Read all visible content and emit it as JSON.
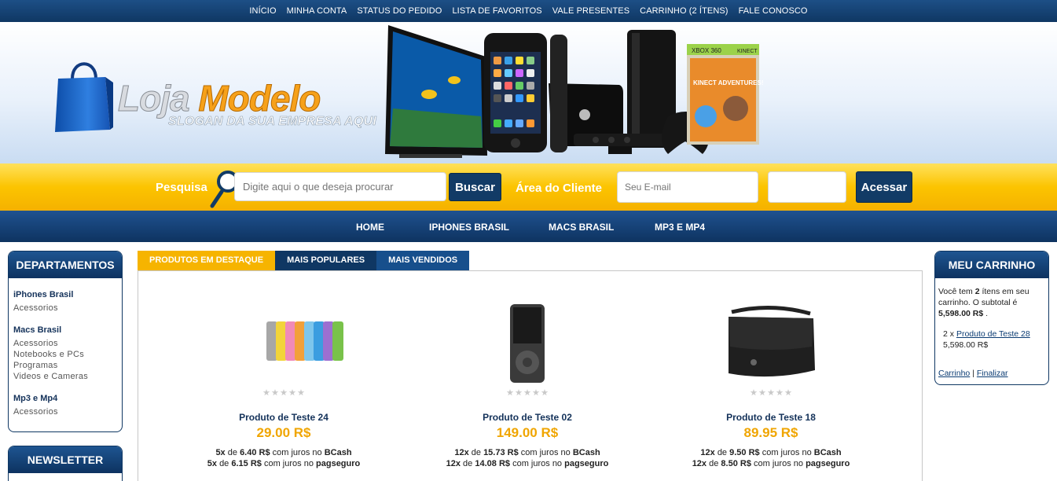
{
  "topnav": [
    "INÍCIO",
    "MINHA CONTA",
    "STATUS DO PEDIDO",
    "LISTA DE FAVORITOS",
    "VALE PRESENTES",
    "CARRINHO (2 ÍTENS)",
    "FALE CONOSCO"
  ],
  "brand": {
    "loja": "Loja",
    "modelo": "Modelo",
    "slogan": "SLOGAN DA SUA EMPRESA AQUI"
  },
  "banner_text": {
    "xbox": "XBOX 360",
    "kinect": "KINECT",
    "game": "KINECT ADVENTURES!"
  },
  "search": {
    "label": "Pesquisa",
    "placeholder": "Digite aqui o que deseja procurar",
    "button": "Buscar"
  },
  "client": {
    "label": "Área do Cliente",
    "email_placeholder": "Seu E-mail",
    "button": "Acessar"
  },
  "mainnav": [
    "HOME",
    "IPHONES BRASIL",
    "MACS BRASIL",
    "MP3 E MP4"
  ],
  "departments": {
    "title": "DEPARTAMENTOS",
    "groups": [
      {
        "title": "iPhones Brasil",
        "items": [
          "Acessorios"
        ]
      },
      {
        "title": "Macs Brasil",
        "items": [
          "Acessorios",
          "Notebooks e PCs",
          "Programas",
          "Videos e Cameras"
        ]
      },
      {
        "title": "Mp3 e Mp4",
        "items": [
          "Acessorios"
        ]
      }
    ]
  },
  "newsletter": {
    "title": "NEWSLETTER"
  },
  "tabs": [
    "PRODUTOS EM DESTAQUE",
    "MAIS POPULARES",
    "MAIS VENDIDOS"
  ],
  "products": [
    {
      "name": "Produto de Teste 24",
      "price": "29.00 R$",
      "inst1": {
        "n": "5x",
        "v": "6.40 R$",
        "via": "BCash"
      },
      "inst2": {
        "n": "5x",
        "v": "6.15 R$",
        "via": "pagseguro"
      }
    },
    {
      "name": "Produto de Teste 02",
      "price": "149.00 R$",
      "inst1": {
        "n": "12x",
        "v": "15.73 R$",
        "via": "BCash"
      },
      "inst2": {
        "n": "12x",
        "v": "14.08 R$",
        "via": "pagseguro"
      }
    },
    {
      "name": "Produto de Teste 18",
      "price": "89.95 R$",
      "inst1": {
        "n": "12x",
        "v": "9.50 R$",
        "via": "BCash"
      },
      "inst2": {
        "n": "12x",
        "v": "8.50 R$",
        "via": "pagseguro"
      }
    }
  ],
  "install_text": {
    "de": "de",
    "juros": "com juros no"
  },
  "cart": {
    "title": "MEU CARRINHO",
    "intro1": "Você tem",
    "count": "2",
    "intro2": "ítens em seu carrinho. O subtotal é",
    "subtotal": "5,598.00 R$",
    "dot": ".",
    "item_qty": "2 x",
    "item_name": "Produto de Teste 28",
    "item_price": "5,598.00 R$",
    "link_cart": "Carrinho",
    "sep": "|",
    "link_finish": "Finalizar"
  },
  "colors": {
    "navy": "#0f3763",
    "yellow": "#fcc400",
    "price_orange": "#f0a500",
    "tab_active": "#f6b400"
  }
}
